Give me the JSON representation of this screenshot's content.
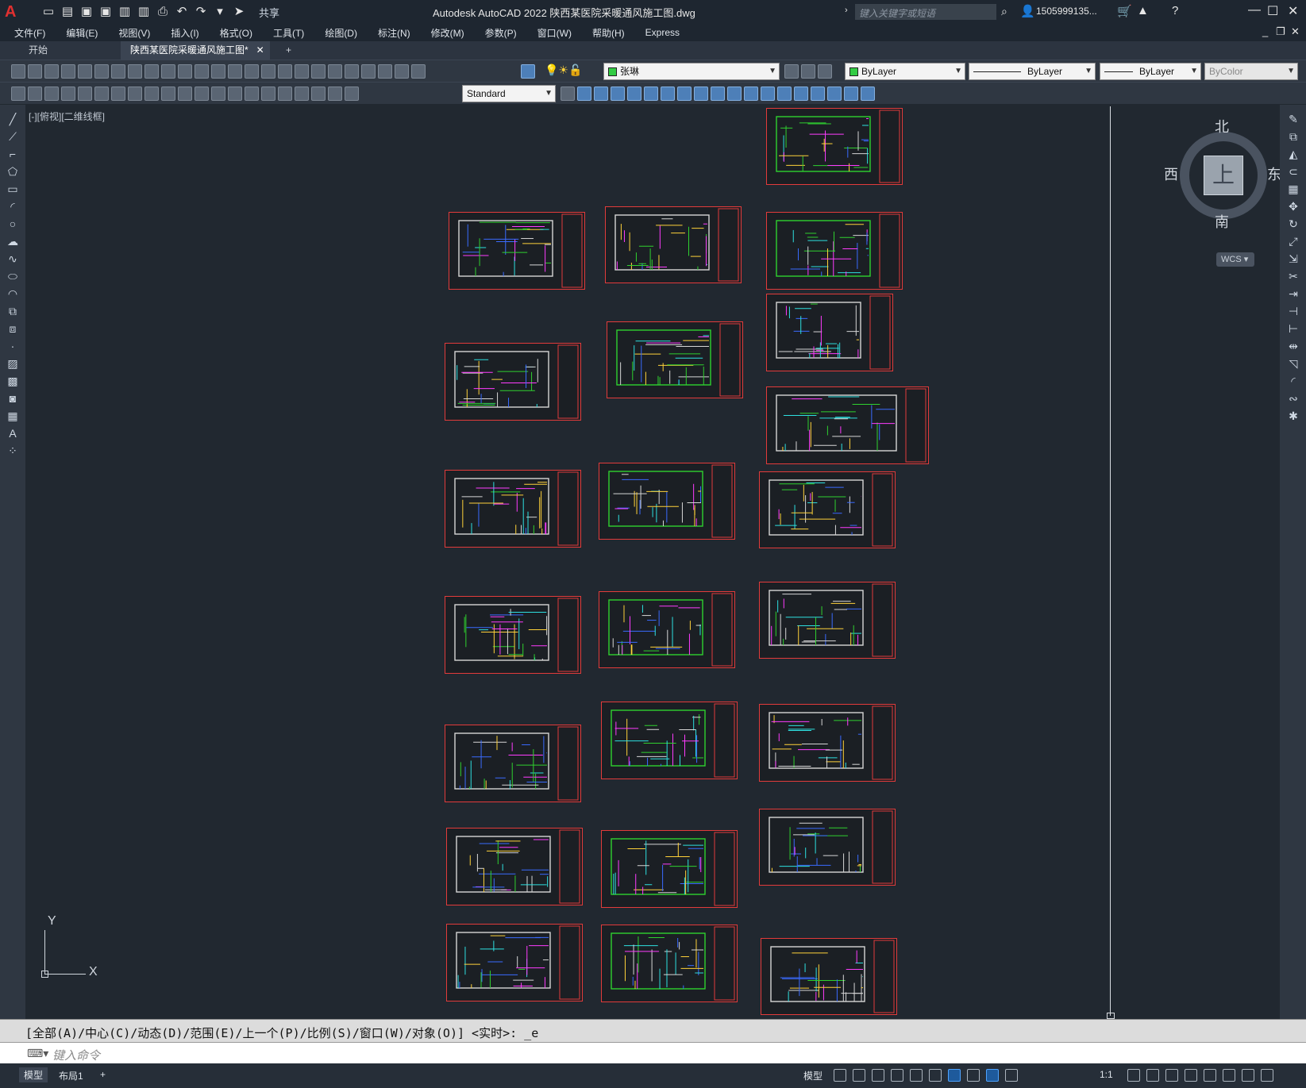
{
  "app": {
    "title": "Autodesk AutoCAD 2022    陕西某医院采暖通风施工图.dwg",
    "logo": "A",
    "share": "共享",
    "search_placeholder": "键入关键字或短语",
    "user": "1505999135..."
  },
  "menu": [
    "文件(F)",
    "编辑(E)",
    "视图(V)",
    "插入(I)",
    "格式(O)",
    "工具(T)",
    "绘图(D)",
    "标注(N)",
    "修改(M)",
    "参数(P)",
    "窗口(W)",
    "帮助(H)",
    "Express"
  ],
  "tabs": [
    {
      "label": "开始",
      "active": false
    },
    {
      "label": "陕西某医院采暖通风施工图*",
      "active": true
    }
  ],
  "layer_combo": "张琳",
  "color_combo": "ByLayer",
  "linetype_combo": "ByLayer",
  "lineweight_combo": "ByLayer",
  "plotstyle_combo": "ByColor",
  "textstyle_combo": "Standard",
  "viewport": {
    "label": "[-][俯视][二维线框]",
    "viewcube": {
      "top": "上",
      "north": "北",
      "south": "南",
      "east": "东",
      "west": "西",
      "wcs": "WCS"
    },
    "ucs": {
      "x": "X",
      "y": "Y"
    }
  },
  "command": {
    "history": "[全部(A)/中心(C)/动态(D)/范围(E)/上一个(P)/比例(S)/窗口(W)/对象(O)] <实时>: _e",
    "placeholder": "键入命令"
  },
  "status": {
    "layout_tabs": [
      "模型",
      "布局1"
    ],
    "model_label": "模型",
    "scale": "1:1"
  },
  "colors": {
    "background": "#212830",
    "sheet_border": "#e23b3b",
    "plan_lines": "#2fd12f"
  }
}
